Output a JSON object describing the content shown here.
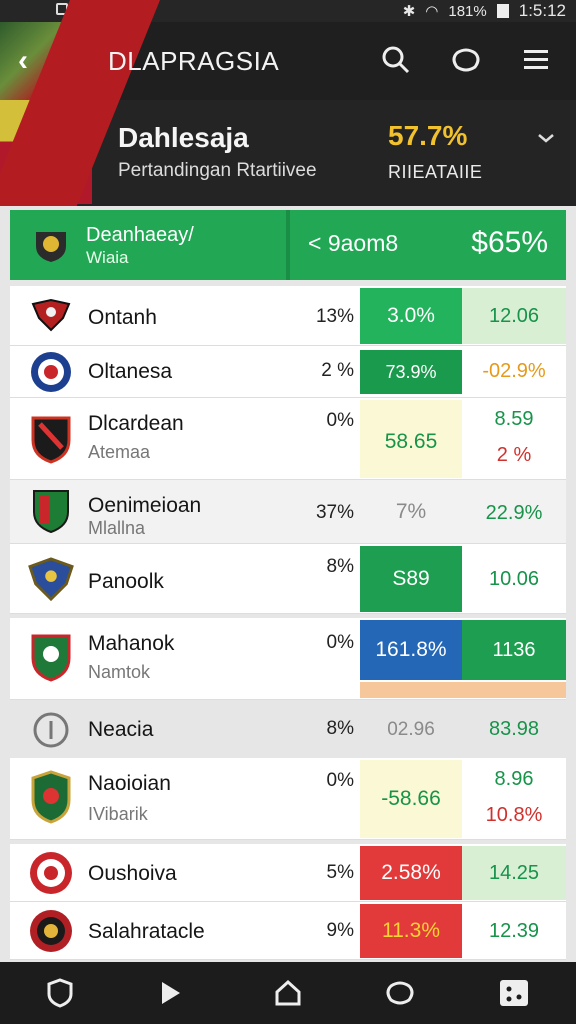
{
  "status_bar": {
    "battery": "181%",
    "time": "1:5:12"
  },
  "header": {
    "title": "DLAPRAGSIA"
  },
  "team": {
    "name": "Dahlesaja",
    "subtitle": "Pertandingan Rtartiivee",
    "percent": "57.7%",
    "relative_label": "RIIEATAIIE"
  },
  "banner": {
    "title": "Deanhaeay/",
    "subtitle": "Wiaia",
    "mid_text": "< 9aom8",
    "value": "$65%"
  },
  "colors": {
    "green": "#22a855",
    "dark_green": "#1a9a4d",
    "blue": "#2467b6",
    "red": "#e23a3a",
    "pale_yellow": "#fbf8d6",
    "pale_green": "#d8efd4",
    "orange_text": "#e59a1b",
    "red_text": "#d0312d",
    "green_text": "#17934a"
  },
  "rows": [
    {
      "name": "Ontanh",
      "sub": "",
      "pct": "13%",
      "val_a": "3.0%",
      "val_b": "12.06",
      "val_b2": ""
    },
    {
      "name": "Oltanesa",
      "sub": "",
      "pct": "2 %",
      "val_a": "73.9%",
      "val_b": "-02.9%",
      "val_b2": ""
    },
    {
      "name": "Dlcardean",
      "sub": "Atemaa",
      "pct": "0%",
      "val_a": "58.65",
      "val_b": "8.59",
      "val_b2": "2 %"
    },
    {
      "name": "Oenimeioan",
      "sub": "Mlallna",
      "pct": "37%",
      "val_a": "7%",
      "val_b": "22.9%",
      "val_b2": ""
    },
    {
      "name": "Panoolk",
      "sub": "",
      "pct": "8%",
      "val_a": "S89",
      "val_b": "10.06",
      "val_b2": ""
    },
    {
      "name": "Mahanok",
      "sub": "Namtok",
      "pct": "0%",
      "val_a": "161.8%",
      "val_b": "1136",
      "val_b2": ""
    },
    {
      "name": "Neacia",
      "sub": "",
      "pct": "8%",
      "val_a": "02.96",
      "val_b": "83.98",
      "val_b2": ""
    },
    {
      "name": "Naoioian",
      "sub": "IVibarik",
      "pct": "0%",
      "val_a": "-58.66",
      "val_b": "8.96",
      "val_b2": "10.8%"
    },
    {
      "name": "Oushoiva",
      "sub": "",
      "pct": "5%",
      "val_a": "2.58%",
      "val_b": "14.25",
      "val_b2": ""
    },
    {
      "name": "Salahratacle",
      "sub": "",
      "pct": "9%",
      "val_a": "11.3%",
      "val_b": "12.39",
      "val_b2": ""
    }
  ]
}
